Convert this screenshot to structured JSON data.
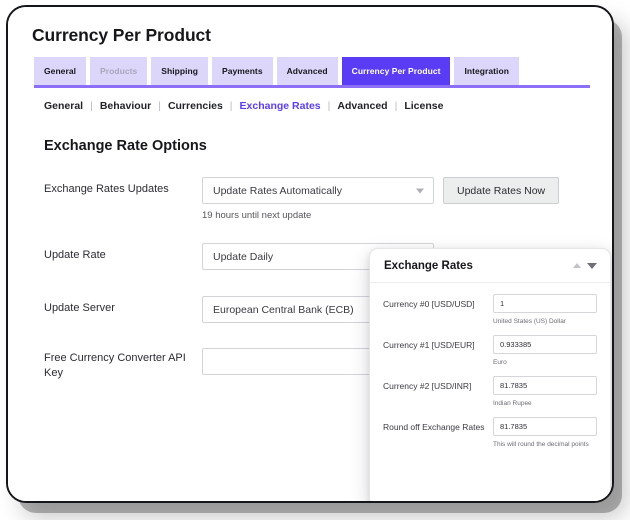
{
  "page": {
    "title": "Currency Per Product"
  },
  "tabs": [
    {
      "label": "General",
      "state": "normal"
    },
    {
      "label": "Products",
      "state": "muted"
    },
    {
      "label": "Shipping",
      "state": "normal"
    },
    {
      "label": "Payments",
      "state": "normal"
    },
    {
      "label": "Advanced",
      "state": "normal"
    },
    {
      "label": "Currency Per Product",
      "state": "active"
    },
    {
      "label": "Integration",
      "state": "normal"
    }
  ],
  "subnav": {
    "items": [
      {
        "label": "General",
        "current": false
      },
      {
        "label": "Behaviour",
        "current": false
      },
      {
        "label": "Currencies",
        "current": false
      },
      {
        "label": "Exchange Rates",
        "current": true
      },
      {
        "label": "Advanced",
        "current": false
      },
      {
        "label": "License",
        "current": false
      }
    ],
    "separator": "|"
  },
  "section": {
    "heading": "Exchange Rate Options"
  },
  "form": {
    "exchange_rates_updates": {
      "label": "Exchange Rates Updates",
      "value": "Update Rates Automatically",
      "note": "19 hours until next update",
      "button_label": "Update Rates Now"
    },
    "update_rate": {
      "label": "Update Rate",
      "value": "Update Daily"
    },
    "update_server": {
      "label": "Update Server",
      "value": "European Central Bank (ECB)"
    },
    "api_key": {
      "label": "Free Currency Converter API Key",
      "value": "",
      "placeholder": ""
    }
  },
  "panel": {
    "title": "Exchange Rates",
    "rows": [
      {
        "label": "Currency #0 [USD/USD]",
        "value": "1",
        "helper": "United States (US) Dollar"
      },
      {
        "label": "Currency #1 [USD/EUR]",
        "value": "0.933385",
        "helper": "Euro"
      },
      {
        "label": "Currency #2 [USD/INR]",
        "value": "81.7835",
        "helper": "Indian Rupee"
      },
      {
        "label": "Round off Exchange Rates",
        "value": "81.7835",
        "helper": "This will round the decimal points"
      }
    ]
  },
  "colors": {
    "accent": "#5b3cf5",
    "tab_bg": "#dcd6fb",
    "underline": "#8b6ff7",
    "frame": "#15161a"
  }
}
